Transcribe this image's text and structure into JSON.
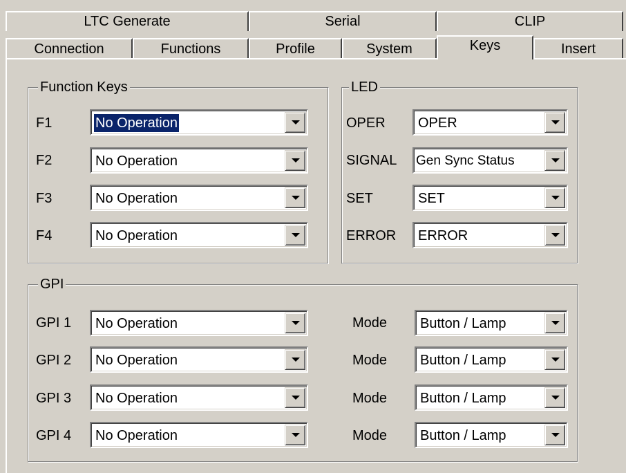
{
  "tabs": {
    "back_row": [
      {
        "label": "LTC Generate"
      },
      {
        "label": "Serial"
      },
      {
        "label": "CLIP"
      }
    ],
    "front_row": [
      {
        "label": "Connection"
      },
      {
        "label": "Functions"
      },
      {
        "label": "Profile"
      },
      {
        "label": "System"
      },
      {
        "label": "Keys",
        "active": true
      },
      {
        "label": "Insert"
      }
    ]
  },
  "function_keys": {
    "legend": "Function Keys",
    "rows": [
      {
        "label": "F1",
        "value": "No Operation",
        "focused": true
      },
      {
        "label": "F2",
        "value": "No Operation"
      },
      {
        "label": "F3",
        "value": "No Operation"
      },
      {
        "label": "F4",
        "value": "No Operation"
      }
    ]
  },
  "led": {
    "legend": "LED",
    "rows": [
      {
        "label": "OPER",
        "value": "OPER"
      },
      {
        "label": "SIGNAL",
        "value": "Gen Sync Status"
      },
      {
        "label": "SET",
        "value": "SET"
      },
      {
        "label": "ERROR",
        "value": "ERROR"
      }
    ]
  },
  "gpi": {
    "legend": "GPI",
    "mode_label": "Mode",
    "rows": [
      {
        "label": "GPI 1",
        "value": "No Operation",
        "mode": "Button / Lamp"
      },
      {
        "label": "GPI 2",
        "value": "No Operation",
        "mode": "Button / Lamp"
      },
      {
        "label": "GPI 3",
        "value": "No Operation",
        "mode": "Button / Lamp"
      },
      {
        "label": "GPI 4",
        "value": "No Operation",
        "mode": "Button / Lamp"
      }
    ]
  },
  "colors": {
    "face": "#d4d0c8",
    "highlight": "#0a246a",
    "field": "#ffffff"
  },
  "icons": {
    "dropdown": "chevron-down-icon"
  }
}
